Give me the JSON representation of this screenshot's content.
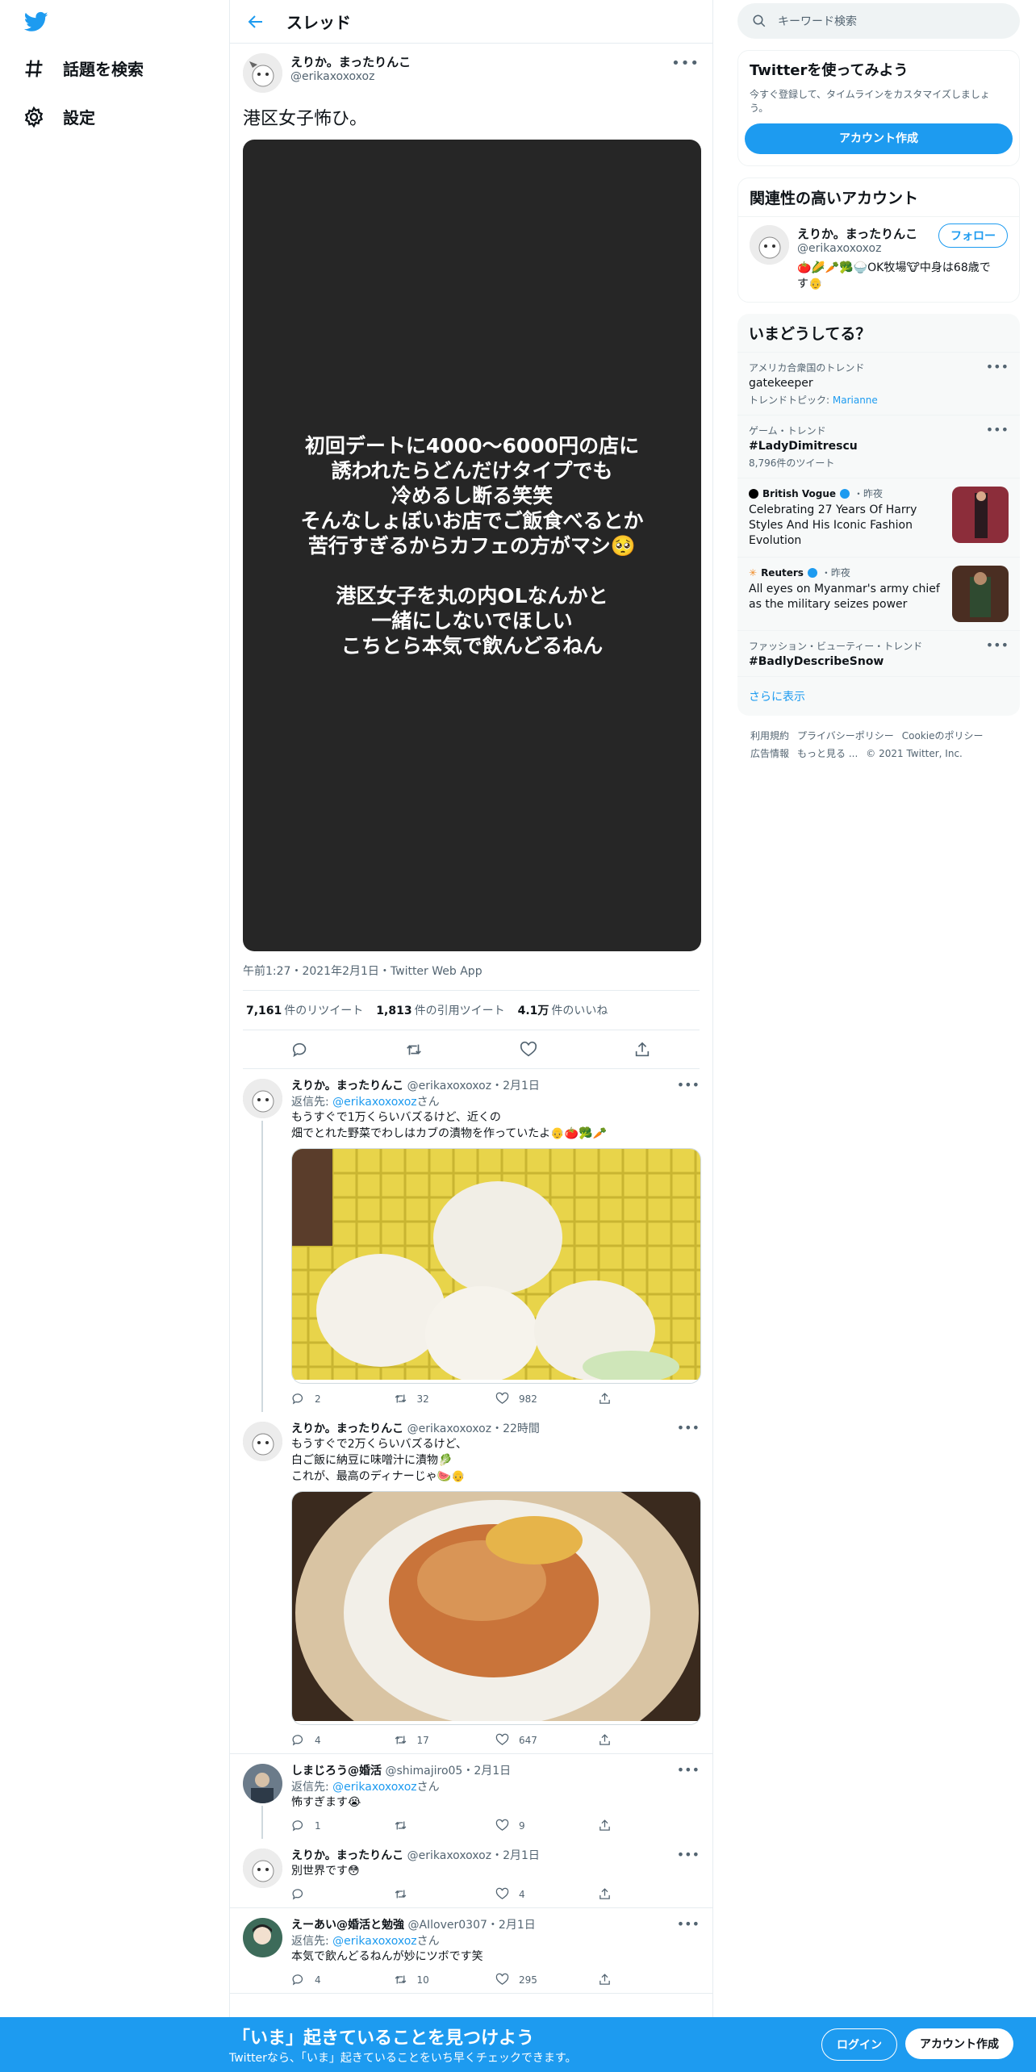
{
  "nav": {
    "explore": "話題を検索",
    "settings": "設定"
  },
  "header": {
    "title": "スレッド"
  },
  "main_tweet": {
    "name": "えりか。まったりんこ",
    "handle": "@erikaxoxoxoz",
    "text": "港区女子怖ひ。",
    "story_lines_1": [
      "初回デートに4000〜6000円の店に",
      "誘われたらどんだけタイプでも",
      "冷めるし断る笑笑",
      "そんなしょぼいお店でご飯食べるとか",
      "苦行すぎるからカフェの方がマシ🥺"
    ],
    "story_lines_2": [
      "港区女子を丸の内OLなんかと",
      "一緒にしないでほしい",
      "こちとら本気で飲んどるねん"
    ],
    "meta": "午前1:27・2021年2月1日・Twitter Web App",
    "retweets": "7,161",
    "retweets_label": "件のリツイート",
    "quotes": "1,813",
    "quotes_label": "件の引用ツイート",
    "likes": "4.1万",
    "likes_label": "件のいいね"
  },
  "replies": [
    {
      "name": "えりか。まったりんこ",
      "handle": "@erikaxoxoxoz",
      "time": "・2月1日",
      "reply_to_prefix": "返信先: ",
      "reply_to": "@erikaxoxoxoz",
      "reply_to_suffix": "さん",
      "lines": [
        "もうすぐで1万くらいバズるけど、近くの",
        "畑でとれた野菜でわしはカブの漬物を作っていたよ👴🍅🥦🥕"
      ],
      "replies": "2",
      "retweets": "32",
      "likes": "982"
    },
    {
      "name": "えりか。まったりんこ",
      "handle": "@erikaxoxoxoz",
      "time": "・22時間",
      "lines": [
        "もうすぐで2万くらいバズるけど、",
        "白ご飯に納豆に味噌汁に漬物🥬",
        "これが、最高のディナーじゃ🍉👴"
      ],
      "replies": "4",
      "retweets": "17",
      "likes": "647"
    },
    {
      "name": "しまじろう@婚活",
      "handle": "@shimajiro05",
      "time": "・2月1日",
      "reply_to_prefix": "返信先: ",
      "reply_to": "@erikaxoxoxoz",
      "reply_to_suffix": "さん",
      "lines": [
        "怖すぎます😭"
      ],
      "replies": "1",
      "retweets": "",
      "likes": "9"
    },
    {
      "name": "えりか。まったりんこ",
      "handle": "@erikaxoxoxoz",
      "time": "・2月1日",
      "lines": [
        "別世界です😳"
      ],
      "replies": "",
      "retweets": "",
      "likes": "4"
    },
    {
      "name": "えーあい@婚活と勉強",
      "handle": "@AIlover0307",
      "time": "・2月1日",
      "reply_to_prefix": "返信先: ",
      "reply_to": "@erikaxoxoxoz",
      "reply_to_suffix": "さん",
      "lines": [
        "本気で飲んどるねんが妙にツボです笑"
      ],
      "replies": "4",
      "retweets": "10",
      "likes": "295"
    }
  ],
  "right": {
    "search_placeholder": "キーワード検索",
    "signup_title": "Twitterを使ってみよう",
    "signup_sub": "今すぐ登録して、タイムラインをカスタマイズしましょう。",
    "signup_button": "アカウント作成",
    "related_title": "関連性の高いアカウント",
    "related_name": "えりか。まったりんこ",
    "related_handle": "@erikaxoxoxoz",
    "follow_button": "フォロー",
    "related_bio": "🍅🌽🥕🥦🍚OK牧場🐮中身は68歳です👴",
    "trends_title": "いまどうしてる？",
    "trends": [
      {
        "cat": "アメリカ合衆国のトレンド",
        "name": "gatekeeper",
        "sub_prefix": "トレンドトピック: ",
        "sub_link": "Marianne"
      },
      {
        "cat": "ゲーム・トレンド",
        "name": "#LadyDimitrescu",
        "sub": "8,796件のツイート"
      }
    ],
    "news": [
      {
        "source": "British Vogue",
        "time": "・昨夜",
        "headline": "Celebrating 27 Years Of Harry Styles And His Iconic Fashion Evolution"
      },
      {
        "source": "Reuters",
        "time": "・昨夜",
        "headline": "All eyes on Myanmar's army chief as the military seizes power"
      }
    ],
    "trend3": {
      "cat": "ファッション・ビューティー・トレンド",
      "name": "#BadlyDescribeSnow"
    },
    "show_more": "さらに表示",
    "footer": [
      "利用規約",
      "プライバシーポリシー",
      "Cookieのポリシー",
      "広告情報",
      "もっと見る ...",
      "© 2021 Twitter, Inc."
    ]
  },
  "bottom_bar": {
    "title": "「いま」起きていることを見つけよう",
    "subtitle": "Twitterなら、「いま」起きていることをいち早くチェックできます。",
    "login": "ログイン",
    "signup": "アカウント作成"
  },
  "colors": {
    "accent": "#1d9bf0",
    "story_bg": "#262626"
  }
}
